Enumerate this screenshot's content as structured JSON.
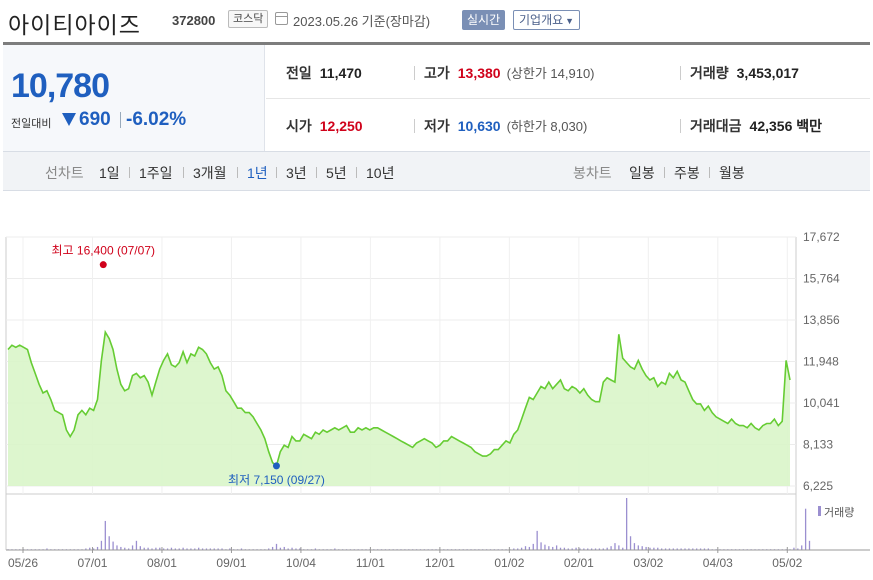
{
  "header": {
    "name": "아이티아이즈",
    "code": "372800",
    "market": "코스닥",
    "date": "2023.05.26 기준(장마감)",
    "realtime_button": "실시간",
    "corp_button": "기업개요"
  },
  "price": {
    "current": "10,780",
    "change_label": "전일대비",
    "change": "690",
    "change_pct": "-6.02%"
  },
  "stats": {
    "prev_close_label": "전일",
    "prev_close": "11,470",
    "high_label": "고가",
    "high": "13,380",
    "upper_limit": "(상한가 14,910)",
    "volume_label": "거래량",
    "volume": "3,453,017",
    "open_label": "시가",
    "open": "12,250",
    "low_label": "저가",
    "low": "10,630",
    "lower_limit": "(하한가 8,030)",
    "amount_label": "거래대금",
    "amount": "42,356 백만"
  },
  "periods": {
    "line_label": "선차트",
    "line_options": [
      "1일",
      "1주일",
      "3개월",
      "1년",
      "3년",
      "5년",
      "10년"
    ],
    "selected": "1년",
    "candle_label": "봉차트",
    "candle_options": [
      "일봉",
      "주봉",
      "월봉"
    ]
  },
  "colors": {
    "up": "#d0021b",
    "down": "#1f5fbf",
    "line": "#66cc33",
    "fill": "#d9f5c9"
  },
  "chart_data": {
    "type": "area",
    "y_ticks": [
      "17,672",
      "15,764",
      "13,856",
      "11,948",
      "10,041",
      "8,133",
      "6,225"
    ],
    "ylim": [
      6225,
      17672
    ],
    "x_ticks": [
      "05/26",
      "07/01",
      "08/01",
      "09/01",
      "10/04",
      "11/01",
      "12/01",
      "01/02",
      "02/01",
      "03/02",
      "04/03",
      "05/02"
    ],
    "high_annotation": "최고 16,400 (07/07)",
    "low_annotation": "최저 7,150 (09/27)",
    "high_value": 16400,
    "low_value": 7150,
    "volume_legend": "거래량",
    "grid": true,
    "series": [
      {
        "values": [
          12500,
          12700,
          12600,
          12700,
          12600,
          12500,
          11900,
          11400,
          10900,
          10500,
          10600,
          10200,
          9700,
          9600,
          9500,
          8800,
          8500,
          8800,
          9500,
          9700,
          9500,
          9800,
          9700,
          10200,
          12000,
          13300,
          13000,
          12500,
          11600,
          10900,
          10600,
          10700,
          11300,
          11400,
          11200,
          11300,
          11000,
          10400,
          11000,
          11600,
          12000,
          12300,
          11800,
          11700,
          11900,
          12400,
          11900,
          12300,
          12200,
          12600,
          12500,
          12300,
          11900,
          11600,
          11700,
          11300,
          10600,
          10400,
          10100,
          9800,
          9800,
          9600,
          9600,
          9400,
          9100,
          8800,
          8400,
          7800,
          7300,
          7150,
          7800,
          8100,
          8000,
          8500,
          8300,
          8300,
          8600,
          8500,
          8400,
          8700,
          8600,
          8800,
          8700,
          8800,
          8900,
          8800,
          8900,
          9000,
          8700,
          8700,
          8900,
          8800,
          8900,
          8800,
          8900,
          8900,
          8800,
          8700,
          8600,
          8500,
          8400,
          8300,
          8200,
          8100,
          8000,
          8200,
          8300,
          8400,
          8300,
          8200,
          8000,
          8100,
          8300,
          8300,
          8500,
          8400,
          8300,
          8200,
          8100,
          8000,
          7800,
          7700,
          7600,
          7600,
          7700,
          7900,
          7900,
          8100,
          8300,
          8200,
          8600,
          8800,
          9300,
          9800,
          10300,
          10200,
          10500,
          10800,
          10700,
          11000,
          10700,
          10900,
          11100,
          10700,
          10600,
          10800,
          10700,
          10500,
          10700,
          10400,
          10200,
          10100,
          10100,
          11000,
          11200,
          11100,
          11000,
          13200,
          12100,
          11900,
          11700,
          11600,
          12000,
          11600,
          11300,
          11100,
          11200,
          10800,
          11000,
          10900,
          11400,
          11200,
          11500,
          11100,
          11000,
          10600,
          10200,
          10000,
          10000,
          9700,
          9900,
          9600,
          9400,
          9300,
          9200,
          9100,
          9300,
          9100,
          9000,
          9000,
          8900,
          9100,
          8900,
          8800,
          9000,
          9100,
          9100,
          9300,
          9000,
          9200,
          12000,
          11100
        ]
      }
    ],
    "volume": [
      1,
      1,
      1,
      1,
      1,
      1,
      1,
      1,
      1,
      1,
      2,
      1,
      1,
      1,
      1,
      1,
      1,
      1,
      1,
      1,
      2,
      3,
      2,
      4,
      12,
      38,
      18,
      11,
      6,
      4,
      3,
      2,
      6,
      12,
      5,
      3,
      3,
      2,
      3,
      3,
      2,
      2,
      3,
      2,
      2,
      3,
      2,
      2,
      2,
      3,
      2,
      2,
      2,
      2,
      2,
      2,
      1,
      2,
      1,
      1,
      2,
      1,
      1,
      1,
      1,
      1,
      1,
      2,
      4,
      8,
      3,
      4,
      2,
      3,
      2,
      2,
      1,
      1,
      1,
      2,
      1,
      1,
      1,
      1,
      2,
      1,
      1,
      1,
      1,
      1,
      1,
      1,
      1,
      1,
      1,
      1,
      1,
      1,
      1,
      1,
      1,
      1,
      1,
      1,
      1,
      1,
      1,
      1,
      1,
      1,
      1,
      1,
      1,
      1,
      1,
      1,
      1,
      1,
      1,
      1,
      1,
      1,
      1,
      1,
      1,
      1,
      1,
      1,
      1,
      1,
      2,
      2,
      3,
      5,
      4,
      8,
      25,
      10,
      7,
      5,
      4,
      6,
      3,
      3,
      2,
      2,
      3,
      2,
      2,
      2,
      2,
      2,
      2,
      2,
      3,
      5,
      9,
      6,
      3,
      68,
      18,
      9,
      6,
      5,
      4,
      3,
      3,
      3,
      2,
      2,
      2,
      2,
      2,
      2,
      2,
      2,
      2,
      2,
      2,
      2,
      2,
      1,
      1,
      1,
      1,
      1,
      1,
      1,
      1,
      1,
      1,
      1,
      1,
      1,
      1,
      1,
      1,
      1,
      1,
      1,
      1,
      1,
      3,
      2,
      6,
      54,
      12
    ]
  }
}
